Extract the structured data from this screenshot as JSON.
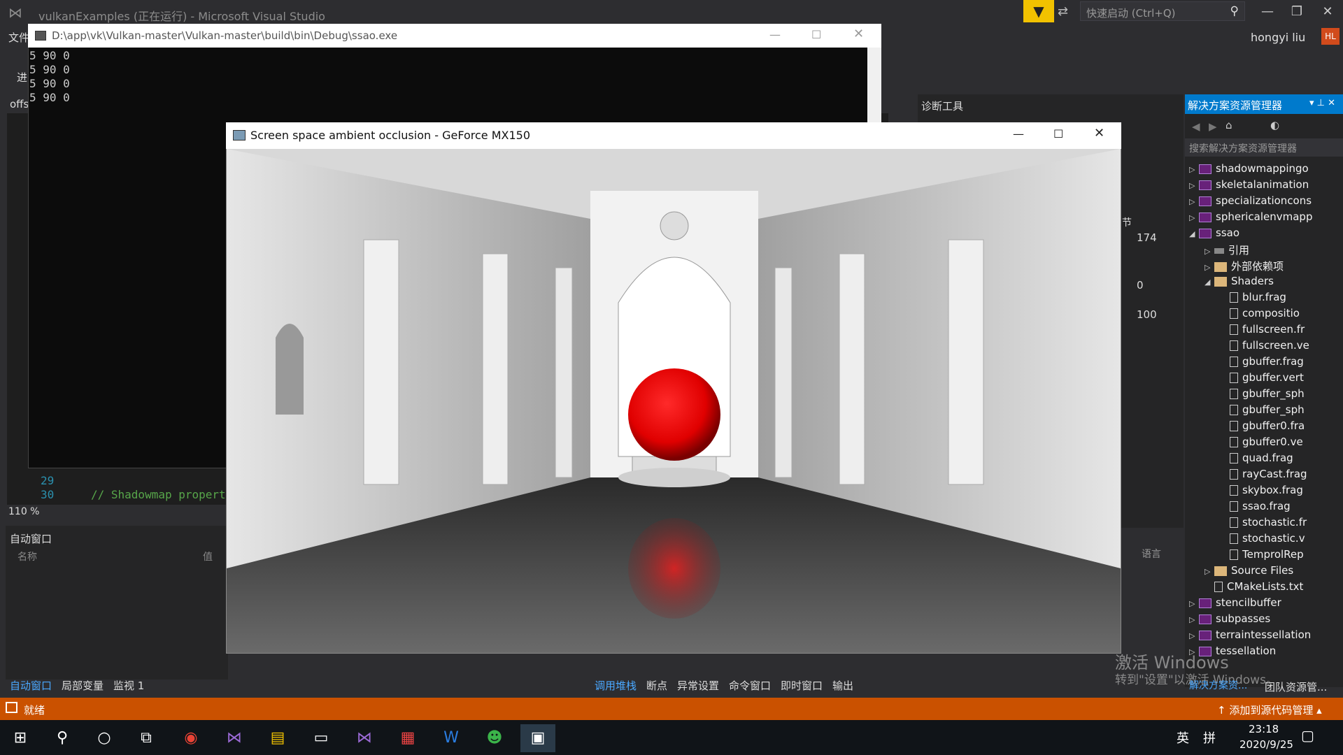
{
  "vs": {
    "title": "vulkanExamples (正在运行) - Microsoft Visual Studio",
    "quick_launch_placeholder": "快速启动 (Ctrl+Q)",
    "user_name": "hongyi liu",
    "user_initials": "HL",
    "menu_file": "文件",
    "left_text_2": "进",
    "left_text_3": "offs"
  },
  "editor": {
    "line_29": "29",
    "line_30": "30",
    "code_30": "// Shadowmap propertie",
    "zoom": "110 %"
  },
  "autos": {
    "title": "自动窗口",
    "col_name": "名称",
    "col_value": "值"
  },
  "diagnostics": {
    "title": "诊断工具",
    "label_jie": "节",
    "val_174": "174",
    "val_0": "0",
    "val_100": "100",
    "lang_label": "语言"
  },
  "solution": {
    "title": "解决方案资源管理器",
    "search_placeholder": "搜索解决方案资源管理器",
    "items": [
      {
        "label": "shadowmappingo",
        "level": 0,
        "arrow": "▷",
        "icon": "project"
      },
      {
        "label": "skeletalanimation",
        "level": 0,
        "arrow": "▷",
        "icon": "project"
      },
      {
        "label": "specializationcons",
        "level": 0,
        "arrow": "▷",
        "icon": "project"
      },
      {
        "label": "sphericalenvmapp",
        "level": 0,
        "arrow": "▷",
        "icon": "project"
      },
      {
        "label": "ssao",
        "level": 0,
        "arrow": "◢",
        "icon": "project"
      },
      {
        "label": "引用",
        "level": 1,
        "arrow": "▷",
        "icon": "ref"
      },
      {
        "label": "外部依赖项",
        "level": 1,
        "arrow": "▷",
        "icon": "folder"
      },
      {
        "label": "Shaders",
        "level": 1,
        "arrow": "◢",
        "icon": "folder"
      },
      {
        "label": "blur.frag",
        "level": 2,
        "arrow": "",
        "icon": "file"
      },
      {
        "label": "compositio",
        "level": 2,
        "arrow": "",
        "icon": "file"
      },
      {
        "label": "fullscreen.fr",
        "level": 2,
        "arrow": "",
        "icon": "file"
      },
      {
        "label": "fullscreen.ve",
        "level": 2,
        "arrow": "",
        "icon": "file"
      },
      {
        "label": "gbuffer.frag",
        "level": 2,
        "arrow": "",
        "icon": "file"
      },
      {
        "label": "gbuffer.vert",
        "level": 2,
        "arrow": "",
        "icon": "file"
      },
      {
        "label": "gbuffer_sph",
        "level": 2,
        "arrow": "",
        "icon": "file"
      },
      {
        "label": "gbuffer_sph",
        "level": 2,
        "arrow": "",
        "icon": "file"
      },
      {
        "label": "gbuffer0.fra",
        "level": 2,
        "arrow": "",
        "icon": "file"
      },
      {
        "label": "gbuffer0.ve",
        "level": 2,
        "arrow": "",
        "icon": "file"
      },
      {
        "label": "quad.frag",
        "level": 2,
        "arrow": "",
        "icon": "file"
      },
      {
        "label": "rayCast.frag",
        "level": 2,
        "arrow": "",
        "icon": "file"
      },
      {
        "label": "skybox.frag",
        "level": 2,
        "arrow": "",
        "icon": "file"
      },
      {
        "label": "ssao.frag",
        "level": 2,
        "arrow": "",
        "icon": "file"
      },
      {
        "label": "stochastic.fr",
        "level": 2,
        "arrow": "",
        "icon": "file"
      },
      {
        "label": "stochastic.v",
        "level": 2,
        "arrow": "",
        "icon": "file"
      },
      {
        "label": "TemprolRep",
        "level": 2,
        "arrow": "",
        "icon": "file"
      },
      {
        "label": "Source Files",
        "level": 1,
        "arrow": "▷",
        "icon": "folder"
      },
      {
        "label": "CMakeLists.txt",
        "level": 1,
        "arrow": "",
        "icon": "file"
      },
      {
        "label": "stencilbuffer",
        "level": 0,
        "arrow": "▷",
        "icon": "project"
      },
      {
        "label": "subpasses",
        "level": 0,
        "arrow": "▷",
        "icon": "project"
      },
      {
        "label": "terraintessellation",
        "level": 0,
        "arrow": "▷",
        "icon": "project"
      },
      {
        "label": "tessellation",
        "level": 0,
        "arrow": "▷",
        "icon": "project"
      }
    ],
    "tab_solution": "解决方案资...",
    "tab_team": "团队资源管..."
  },
  "watermark": {
    "line1": "激活 Windows",
    "line2": "转到\"设置\"以激活 Windows。"
  },
  "bottom_tabs": {
    "left": [
      "自动窗口",
      "局部变量",
      "监视 1"
    ],
    "right": [
      "调用堆栈",
      "断点",
      "异常设置",
      "命令窗口",
      "即时窗口",
      "输出"
    ]
  },
  "status": {
    "ready": "就绪",
    "source_control": "添加到源代码管理"
  },
  "console": {
    "title": "D:\\app\\vk\\Vulkan-master\\Vulkan-master\\build\\bin\\Debug\\ssao.exe",
    "lines": [
      "5 90 0",
      "5 90 0",
      "5 90 0",
      "5 90 0"
    ]
  },
  "ssao": {
    "title": "Screen space ambient occlusion - GeForce MX150"
  },
  "taskbar": {
    "time": "23:18",
    "date": "2020/9/25",
    "ime": "英",
    "ime2": "拼"
  }
}
